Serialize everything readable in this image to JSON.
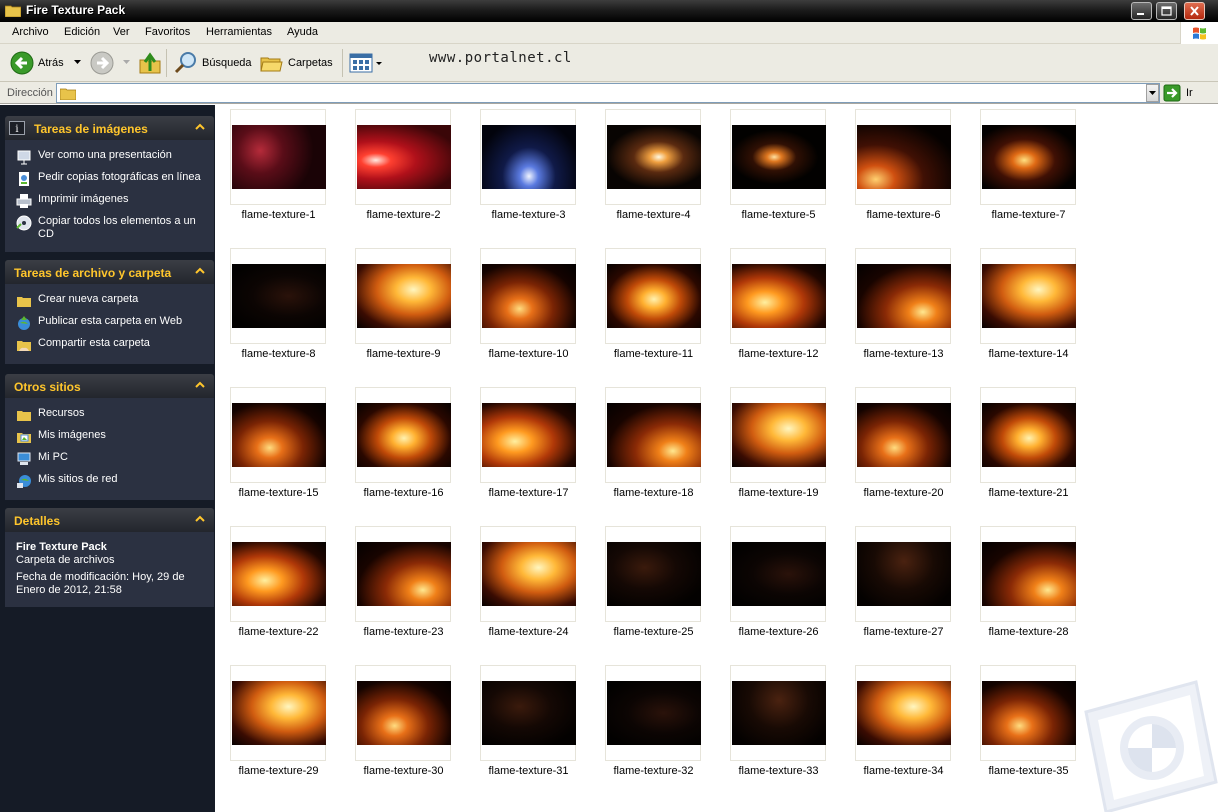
{
  "window": {
    "title": "Fire Texture Pack"
  },
  "menu": [
    "Archivo",
    "Edición",
    "Ver",
    "Favoritos",
    "Herramientas",
    "Ayuda"
  ],
  "toolbar": {
    "back_label": "Atrás",
    "search_label": "Búsqueda",
    "folders_label": "Carpetas",
    "watermark": "www.portalnet.cl"
  },
  "address": {
    "label": "Dirección",
    "value": "",
    "go_label": "Ir"
  },
  "taskpane": {
    "image_tasks": {
      "title": "Tareas de imágenes",
      "items": [
        "Ver como una presentación",
        "Pedir copias fotográficas en línea",
        "Imprimir imágenes",
        "Copiar todos los elementos a un CD"
      ]
    },
    "file_tasks": {
      "title": "Tareas de archivo y carpeta",
      "items": [
        "Crear nueva carpeta",
        "Publicar esta carpeta en Web",
        "Compartir esta carpeta"
      ]
    },
    "other_places": {
      "title": "Otros sitios",
      "items": [
        "Recursos",
        "Mis imágenes",
        "Mi PC",
        "Mis sitios de red"
      ]
    },
    "details": {
      "title": "Detalles",
      "name": "Fire Texture Pack",
      "type": "Carpeta de archivos",
      "modified": "Fecha de modificación: Hoy, 29 de Enero de 2012, 21:58"
    }
  },
  "files": [
    "flame-texture-1",
    "flame-texture-2",
    "flame-texture-3",
    "flame-texture-4",
    "flame-texture-5",
    "flame-texture-6",
    "flame-texture-7",
    "flame-texture-8",
    "flame-texture-9",
    "flame-texture-10",
    "flame-texture-11",
    "flame-texture-12",
    "flame-texture-13",
    "flame-texture-14",
    "flame-texture-15",
    "flame-texture-16",
    "flame-texture-17",
    "flame-texture-18",
    "flame-texture-19",
    "flame-texture-20",
    "flame-texture-21",
    "flame-texture-22",
    "flame-texture-23",
    "flame-texture-24",
    "flame-texture-25",
    "flame-texture-26",
    "flame-texture-27",
    "flame-texture-28",
    "flame-texture-29",
    "flame-texture-30",
    "flame-texture-31",
    "flame-texture-32",
    "flame-texture-33",
    "flame-texture-34",
    "flame-texture-35"
  ],
  "colors": {
    "pane_bg": "#151b26",
    "pane_body": "#2b3141",
    "pane_title": "#ffc62c"
  }
}
